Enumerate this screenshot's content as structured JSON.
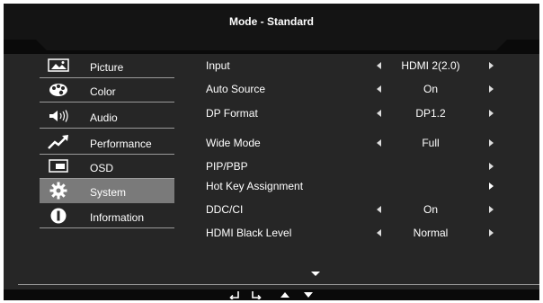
{
  "header": {
    "title": "Mode - Standard"
  },
  "menu": {
    "items": [
      {
        "label": "Picture",
        "icon": "picture-icon",
        "selected": false
      },
      {
        "label": "Color",
        "icon": "color-palette-icon",
        "selected": false
      },
      {
        "label": "Audio",
        "icon": "speaker-icon",
        "selected": false
      },
      {
        "label": "Performance",
        "icon": "performance-icon",
        "selected": false
      },
      {
        "label": "OSD",
        "icon": "osd-icon",
        "selected": false
      },
      {
        "label": "System",
        "icon": "gear-icon",
        "selected": true
      },
      {
        "label": "Information",
        "icon": "info-icon",
        "selected": false
      }
    ]
  },
  "settings": {
    "rows": [
      {
        "label": "Input",
        "value": "HDMI 2(2.0)"
      },
      {
        "label": "Auto Source",
        "value": "On"
      },
      {
        "label": "DP Format",
        "value": "DP1.2"
      },
      {
        "label": "Wide Mode",
        "value": "Full"
      },
      {
        "label": "PIP/PBP",
        "value": ""
      },
      {
        "label": "Hot Key Assignment",
        "value": ""
      },
      {
        "label": "DDC/CI",
        "value": "On"
      },
      {
        "label": "HDMI Black Level",
        "value": "Normal"
      }
    ]
  },
  "footer": {
    "keys": [
      "back-icon",
      "enter-icon",
      "up-arrow-icon",
      "down-arrow-icon"
    ]
  },
  "colors": {
    "background": "#262626",
    "header": "#0a0a0a",
    "selected": "#7a7a7a",
    "text": "#ffffff"
  }
}
